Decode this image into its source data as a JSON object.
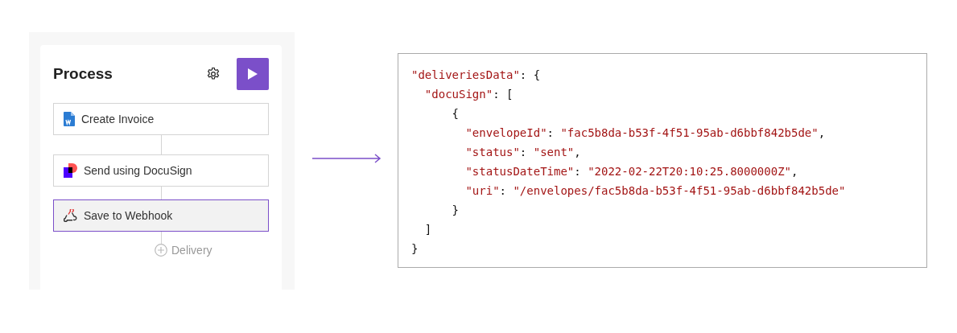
{
  "process": {
    "title": "Process",
    "steps": [
      {
        "kind": "word",
        "label": "Create Invoice",
        "selected": false
      },
      {
        "kind": "docusign",
        "label": "Send using DocuSign",
        "selected": false
      },
      {
        "kind": "webhook",
        "label": "Save to Webhook",
        "selected": true
      }
    ],
    "add_label": "Delivery"
  },
  "code": {
    "lines": [
      [
        {
          "kind": "key",
          "text": "\"deliveriesData\""
        },
        {
          "kind": "punct",
          "text": ": {"
        }
      ],
      [
        {
          "kind": "key",
          "text": "  \"docuSign\""
        },
        {
          "kind": "punct",
          "text": ": ["
        }
      ],
      [
        {
          "kind": "punct",
          "text": "      {"
        }
      ],
      [
        {
          "kind": "key",
          "text": "        \"envelopeId\""
        },
        {
          "kind": "punct",
          "text": ": "
        },
        {
          "kind": "string",
          "text": "\"fac5b8da-b53f-4f51-95ab-d6bbf842b5de\""
        },
        {
          "kind": "punct",
          "text": ","
        }
      ],
      [
        {
          "kind": "key",
          "text": "        \"status\""
        },
        {
          "kind": "punct",
          "text": ": "
        },
        {
          "kind": "string",
          "text": "\"sent\""
        },
        {
          "kind": "punct",
          "text": ","
        }
      ],
      [
        {
          "kind": "key",
          "text": "        \"statusDateTime\""
        },
        {
          "kind": "punct",
          "text": ": "
        },
        {
          "kind": "string",
          "text": "\"2022-02-22T20:10:25.8000000Z\""
        },
        {
          "kind": "punct",
          "text": ","
        }
      ],
      [
        {
          "kind": "key",
          "text": "        \"uri\""
        },
        {
          "kind": "punct",
          "text": ": "
        },
        {
          "kind": "string",
          "text": "\"/envelopes/fac5b8da-b53f-4f51-95ab-d6bbf842b5de\""
        }
      ],
      [
        {
          "kind": "punct",
          "text": "      }"
        }
      ],
      [
        {
          "kind": "punct",
          "text": "  ]"
        }
      ],
      [
        {
          "kind": "punct",
          "text": "}"
        }
      ]
    ]
  }
}
